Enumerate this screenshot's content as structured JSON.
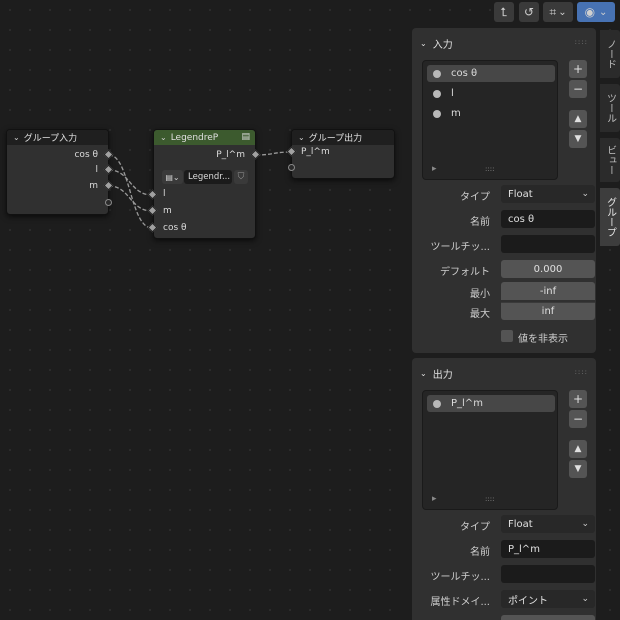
{
  "toolbar": {
    "buttons": [
      {
        "icon": "arrow-up-icon",
        "glyph": "⮤"
      },
      {
        "icon": "loop-icon",
        "glyph": "↺"
      },
      {
        "icon": "grid-snap-icon",
        "glyph": "⌗"
      },
      {
        "icon": "overlay-icon",
        "glyph": "◉"
      }
    ],
    "chevron": "⌄"
  },
  "nodes": {
    "group_input": {
      "title": "グループ入力",
      "outputs": [
        "cos θ",
        "l",
        "m"
      ]
    },
    "legendre": {
      "title": "LegendreP",
      "header_color": "#3c5a2e",
      "output": "P_l^m",
      "datablock": "Legendr...",
      "inputs": [
        "l",
        "m",
        "cos θ"
      ]
    },
    "group_output": {
      "title": "グループ出力",
      "inputs": [
        "P_l^m"
      ]
    }
  },
  "side_tabs": [
    "ノード",
    "ツール",
    "ビュー",
    "グループ"
  ],
  "inputs_panel": {
    "title": "入力",
    "items": [
      "cos θ",
      "l",
      "m"
    ],
    "selected_index": 0,
    "add": "+",
    "remove": "−",
    "move_up": "▲",
    "move_down": "▼",
    "expand": "▸",
    "grip": "::::",
    "props": {
      "type_label": "タイプ",
      "type_value": "Float",
      "name_label": "名前",
      "name_value": "cos θ",
      "tooltip_label": "ツールチッ...",
      "tooltip_value": "",
      "default_label": "デフォルト",
      "default_value": "0.000",
      "min_label": "最小",
      "min_value": "-inf",
      "max_label": "最大",
      "max_value": "inf",
      "hide_value_label": "値を非表示"
    }
  },
  "outputs_panel": {
    "title": "出力",
    "items": [
      "P_l^m"
    ],
    "selected_index": 0,
    "add": "+",
    "remove": "−",
    "move_up": "▲",
    "move_down": "▼",
    "expand": "▸",
    "grip": "::::",
    "props": {
      "type_label": "タイプ",
      "type_value": "Float",
      "name_label": "名前",
      "name_value": "P_l^m",
      "tooltip_label": "ツールチッ...",
      "tooltip_value": "",
      "attr_domain_label": "属性ドメイ...",
      "attr_domain_value": "ポイント"
    }
  }
}
